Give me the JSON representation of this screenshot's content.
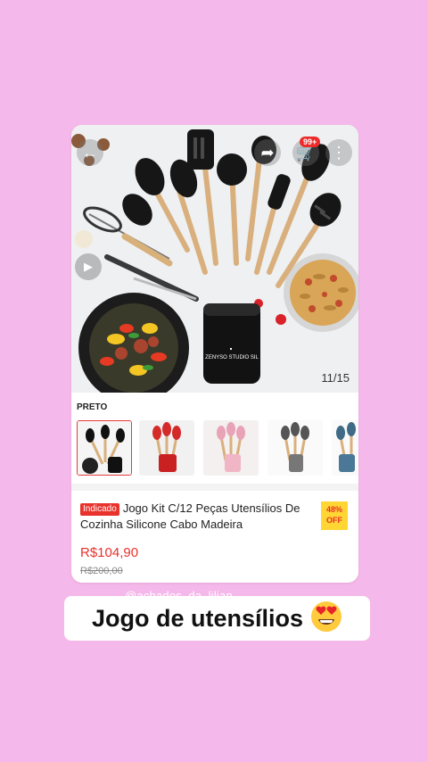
{
  "background_color": "#f5b8ea",
  "product_view": {
    "image_counter": "11/15",
    "cart_badge": "99+",
    "variant_label": "PRETO",
    "thumbnails": [
      "black-utensil-set",
      "red-utensil-set",
      "pink-utensil-set",
      "gray-utensil-set",
      "blue-utensil-set"
    ],
    "badge": "Indicado",
    "title": "Jogo Kit C/12 Peças Utensílios De Cozinha  Silicone Cabo Madeira",
    "discount_percent": "48%",
    "discount_label": "OFF",
    "price": "R$104,90",
    "old_price": "R$200,00",
    "canister_text": "ZENYSO STUDIO SIL"
  },
  "story": {
    "username": "@achados_da_lilian",
    "caption": "Jogo de utensílios",
    "caption_emoji": "heart-eyes-emoji"
  },
  "colors": {
    "price_red": "#e8322b",
    "badge_yellow": "#ffd633"
  }
}
